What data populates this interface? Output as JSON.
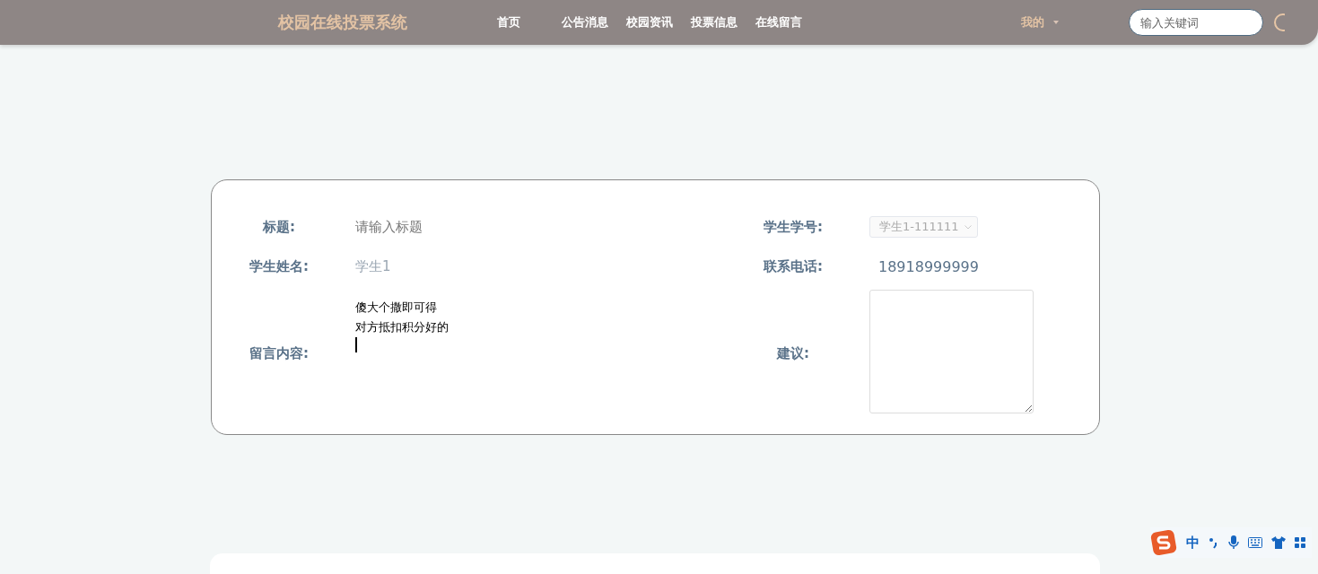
{
  "header": {
    "site_title": "校园在线投票系统",
    "nav": [
      {
        "label": "首页",
        "selected": false
      },
      {
        "label": "公告消息",
        "selected": false
      },
      {
        "label": "校园资讯",
        "selected": false
      },
      {
        "label": "投票信息",
        "selected": false
      },
      {
        "label": "在线留言",
        "selected": false
      }
    ],
    "user_menu": {
      "label": "我的"
    },
    "search": {
      "placeholder": "输入关键词"
    }
  },
  "form": {
    "title": {
      "label": "标题:",
      "placeholder": "请输入标题"
    },
    "student_id": {
      "label": "学生学号:",
      "value": "学生1-111111",
      "disabled": true
    },
    "student_name": {
      "label": "学生姓名:",
      "value": "学生1"
    },
    "phone": {
      "label": "联系电话:",
      "value": "18918999999"
    },
    "message": {
      "label": "留言内容:",
      "lines": [
        "傻大个撒即可得",
        "对方抵扣积分好的"
      ]
    },
    "suggestion": {
      "label": "建议:"
    }
  },
  "ime_toolbar": {
    "mode": "中"
  }
}
